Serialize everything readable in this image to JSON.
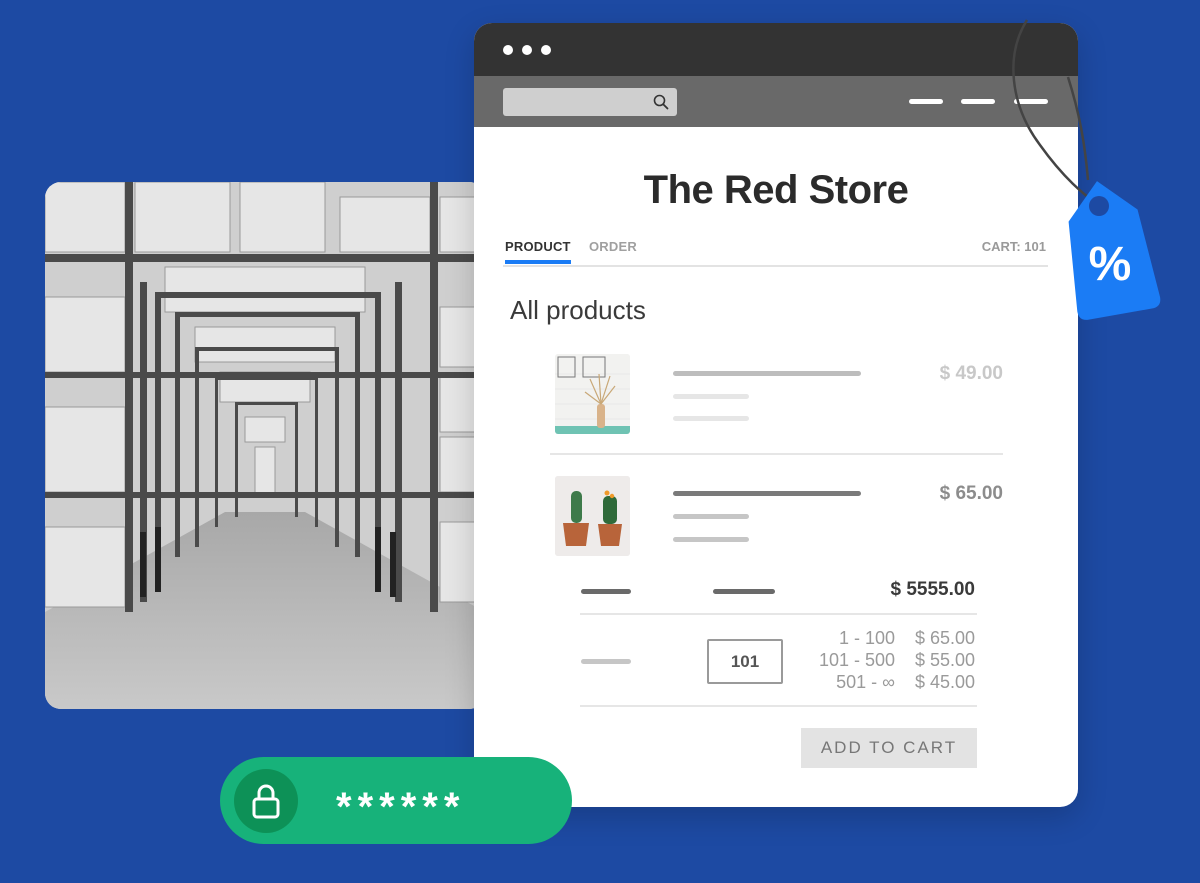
{
  "warehouse_photo": {
    "alt": "Warehouse aisle with pallet racks"
  },
  "browser": {
    "window_controls": [
      "dot",
      "dot",
      "dot"
    ],
    "search": {
      "placeholder": "",
      "icon": "search-icon"
    },
    "menu_icon": "hamburger-dashes-icon",
    "store_title": "The Red Store",
    "tabs": [
      {
        "label": "PRODUCT",
        "active": true
      },
      {
        "label": "ORDER",
        "active": false
      }
    ],
    "cart_label": "CART: 101",
    "section_title": "All products",
    "products": [
      {
        "image": "dried-pampas-vase",
        "price": "$ 49.00"
      },
      {
        "image": "two-cacti-in-pots",
        "price": "$ 65.00"
      }
    ],
    "order_summary": {
      "total": "$ 5555.00",
      "quantity": "101",
      "price_tiers": [
        {
          "range": "1 - 100",
          "price": "$ 65.00"
        },
        {
          "range": "101 - 500",
          "price": "$ 55.00"
        },
        {
          "range": "501 - ∞",
          "price": "$ 45.00"
        }
      ],
      "add_to_cart_label": "ADD TO CART"
    }
  },
  "discount_tag": {
    "symbol": "%"
  },
  "password_field": {
    "masked_value": "******",
    "icon": "lock-icon"
  },
  "colors": {
    "background": "#1d4aa3",
    "accent_blue": "#1b7cf5",
    "titlebar": "#333333",
    "navbar": "#696969",
    "password_green": "#17b27a",
    "lock_green": "#0d9157"
  }
}
